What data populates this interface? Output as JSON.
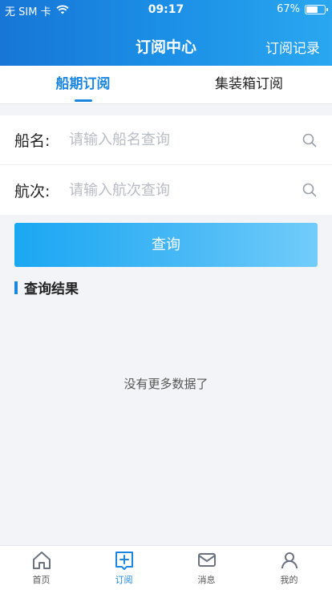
{
  "status_bar": {
    "carrier": "无 SIM 卡",
    "time": "09:17",
    "battery": "67%",
    "battery_level": 0.67
  },
  "nav": {
    "title": "订阅中心",
    "right_action": "订阅记录"
  },
  "tabs": [
    {
      "label": "船期订阅",
      "active": true
    },
    {
      "label": "集装箱订阅",
      "active": false
    }
  ],
  "form": {
    "ship_name": {
      "label": "船名:",
      "placeholder": "请输入船名查询"
    },
    "voyage": {
      "label": "航次:",
      "placeholder": "请输入航次查询"
    }
  },
  "query_button": "查询",
  "results": {
    "title": "查询结果",
    "empty_text": "没有更多数据了"
  },
  "tabbar": [
    {
      "label": "首页",
      "icon": "home-icon"
    },
    {
      "label": "订阅",
      "icon": "subscribe-icon",
      "active": true
    },
    {
      "label": "消息",
      "icon": "message-icon"
    },
    {
      "label": "我的",
      "icon": "profile-icon"
    }
  ],
  "colors": {
    "primary": "#1a86e0",
    "header_start": "#1776d6",
    "header_end": "#2aa7f0",
    "button": "#1aa7f2"
  }
}
